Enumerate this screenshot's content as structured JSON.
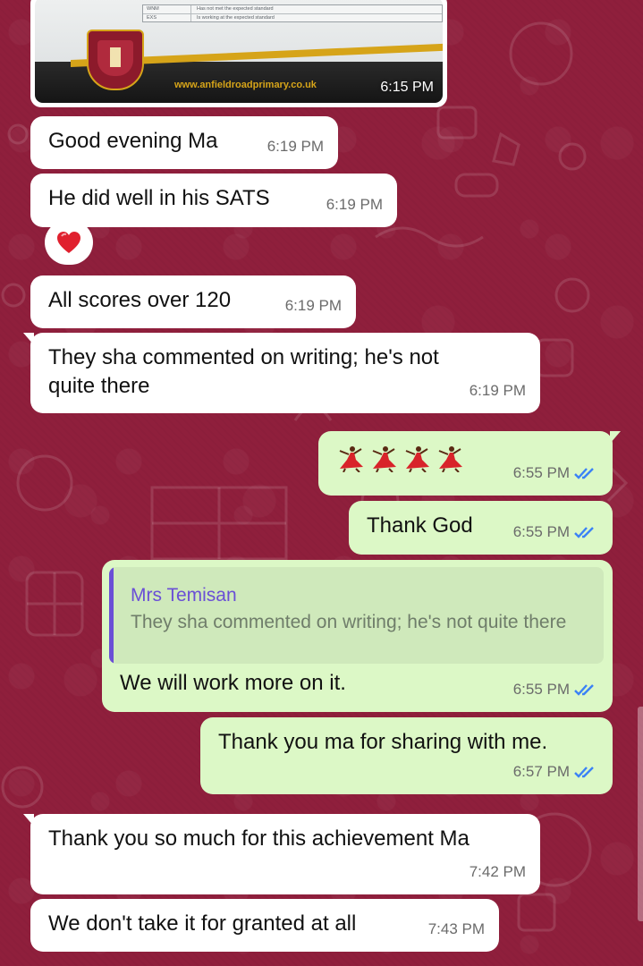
{
  "chat": {
    "image_message": {
      "table_rows": [
        {
          "code": "WNM",
          "desc": "Has not met the expected standard"
        },
        {
          "code": "EXS",
          "desc": "Is working at the expected standard"
        }
      ],
      "url": "www.anfieldroadprimary.co.uk",
      "time": "6:15 PM"
    },
    "messages": [
      {
        "text": "Good evening Ma",
        "time": "6:19 PM",
        "direction": "incoming"
      },
      {
        "text": "He did well in his SATS",
        "time": "6:19 PM",
        "direction": "incoming"
      },
      {
        "text": "All scores over 120",
        "time": "6:19 PM",
        "direction": "incoming"
      },
      {
        "text": "They sha commented on writing; he's not quite there",
        "time": "6:19 PM",
        "direction": "incoming"
      },
      {
        "text": "💃💃💃💃",
        "time": "6:55 PM",
        "direction": "outgoing"
      },
      {
        "text": "Thank God",
        "time": "6:55 PM",
        "direction": "outgoing"
      },
      {
        "text": "We will work more on it.",
        "time": "6:55 PM",
        "direction": "outgoing"
      },
      {
        "text": "Thank you ma for sharing with me.",
        "time": "6:57 PM",
        "direction": "outgoing"
      },
      {
        "text": "Thank you so much for this achievement Ma",
        "time": "7:42 PM",
        "direction": "incoming"
      },
      {
        "text": "We don't take it for granted at all",
        "time": "7:43 PM",
        "direction": "incoming"
      }
    ],
    "reaction": {
      "icon": "red-heart"
    },
    "quoted_reply": {
      "author": "Mrs Temisan",
      "text": "They sha commented on writing; he's not quite there"
    },
    "tick_status": "read-double-check",
    "colors": {
      "background": "#8f1f3c",
      "incoming_bubble": "#ffffff",
      "outgoing_bubble": "#dcf8c6",
      "read_ticks": "#3b82f6",
      "quote_author": "#6a4fd6",
      "heart": "#e0202e"
    }
  }
}
